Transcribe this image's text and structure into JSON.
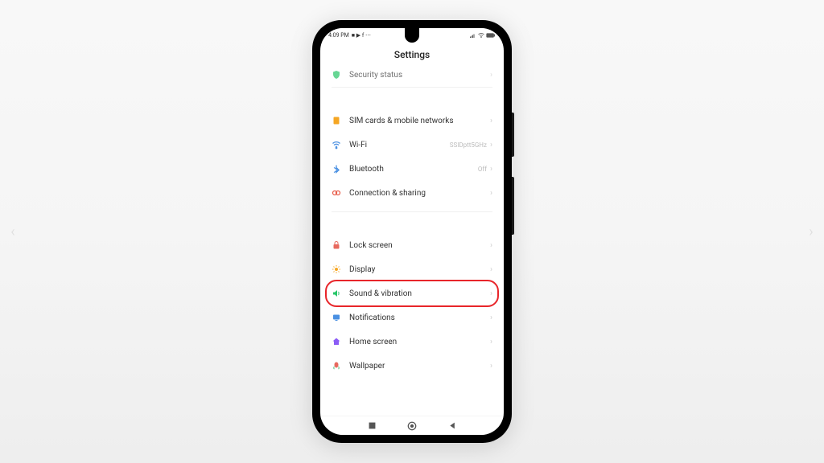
{
  "status": {
    "time": "4:09 PM",
    "icons_left": "■ ▶ f ⋯"
  },
  "header": {
    "title": "Settings"
  },
  "partial_item": {
    "label": "Security status"
  },
  "groups": [
    {
      "items": [
        {
          "icon": "sim",
          "color": "#f5a623",
          "label": "SIM cards & mobile networks",
          "value": ""
        },
        {
          "icon": "wifi",
          "color": "#4a90e2",
          "label": "Wi-Fi",
          "value": "SSIDptt5GHz"
        },
        {
          "icon": "bluetooth",
          "color": "#4a90e2",
          "label": "Bluetooth",
          "value": "Off"
        },
        {
          "icon": "connection",
          "color": "#e85d4a",
          "label": "Connection & sharing",
          "value": ""
        }
      ]
    },
    {
      "items": [
        {
          "icon": "lock",
          "color": "#e8695e",
          "label": "Lock screen",
          "value": ""
        },
        {
          "icon": "display",
          "color": "#f5a623",
          "label": "Display",
          "value": ""
        },
        {
          "icon": "sound",
          "color": "#27c668",
          "label": "Sound & vibration",
          "value": "",
          "highlighted": true
        },
        {
          "icon": "notifications",
          "color": "#4a90e2",
          "label": "Notifications",
          "value": ""
        },
        {
          "icon": "home",
          "color": "#8b5cf6",
          "label": "Home screen",
          "value": ""
        },
        {
          "icon": "wallpaper",
          "color": "#e8695e",
          "label": "Wallpaper",
          "value": ""
        }
      ]
    }
  ],
  "svg": {
    "shield": "<svg viewBox='0 0 24 24' fill='#27c668'><path d='M12 2l8 3v6c0 5-3.5 9.5-8 11-4.5-1.5-8-6-8-11V5l8-3z'/></svg>",
    "sim": "<svg viewBox='0 0 24 24' fill='#f5a623'><rect x='5' y='3' width='14' height='18' rx='2'/></svg>",
    "wifi": "<svg viewBox='0 0 24 24' fill='none' stroke='#4a90e2' stroke-width='2.5'><path d='M3 9c5-5 13-5 18 0M6 13c3.5-3.5 8.5-3.5 12 0M10 17c1-1 3-1 4 0'/><circle cx='12' cy='20' r='1.5' fill='#4a90e2'/></svg>",
    "bluetooth": "<svg viewBox='0 0 24 24' fill='none' stroke='#4a90e2' stroke-width='2.5'><path d='M12 3v18l6-6-12-6m0 12l12-6-6-6'/></svg>",
    "connection": "<svg viewBox='0 0 24 24' fill='none' stroke='#e85d4a' stroke-width='2.5'><circle cx='8' cy='12' r='5'/><circle cx='16' cy='12' r='5'/></svg>",
    "lock": "<svg viewBox='0 0 24 24' fill='#e8695e'><rect x='5' y='10' width='14' height='11' rx='2'/><path d='M8 10V7a4 4 0 018 0v3' fill='none' stroke='#e8695e' stroke-width='2'/></svg>",
    "display": "<svg viewBox='0 0 24 24' fill='#f5a623'><circle cx='12' cy='12' r='4'/><g stroke='#f5a623' stroke-width='2'><line x1='12' y1='2' x2='12' y2='5'/><line x1='12' y1='19' x2='12' y2='22'/><line x1='2' y1='12' x2='5' y2='12'/><line x1='19' y1='12' x2='22' y2='12'/><line x1='5' y1='5' x2='7' y2='7'/><line x1='17' y1='17' x2='19' y2='19'/><line x1='5' y1='19' x2='7' y2='17'/><line x1='17' y1='7' x2='19' y2='5'/></g></svg>",
    "sound": "<svg viewBox='0 0 24 24' fill='#27c668'><path d='M4 9v6h4l6 5V4L8 9H4z'/><path d='M17 8c1.5 1 1.5 7 0 8' fill='none' stroke='#27c668' stroke-width='2'/></svg>",
    "notifications": "<svg viewBox='0 0 24 24' fill='#4a90e2'><rect x='4' y='5' width='16' height='12' rx='2'/><rect x='9' y='18' width='6' height='2' fill='#4a90e2'/></svg>",
    "home": "<svg viewBox='0 0 24 24' fill='#8b5cf6'><path d='M12 3l9 8h-3v9H6v-9H3l9-8z'/></svg>",
    "wallpaper": "<svg viewBox='0 0 24 24' fill='#e8695e'><path d='M12 3c4 0 5 4 5 7 0 4-3 7-5 7s-5-3-5-7c0-3 1-7 5-7z'/><path d='M7 14c-2 2-2 5 0 6M17 14c2 2 2 5 0 6' stroke='#5bbf7e' stroke-width='2' fill='none'/></svg>",
    "signal": "<svg viewBox='0 0 16 12' fill='#555'><rect x='0' y='9' width='2' height='3'/><rect x='3' y='7' width='2' height='5'/><rect x='6' y='5' width='2' height='7'/><rect x='9' y='3' width='2' height='9'/></svg>",
    "wifi_s": "<svg viewBox='0 0 16 12' fill='none' stroke='#555' stroke-width='1.5'><path d='M1 4c4-4 10-4 14 0M4 7c2-2 6-2 8 0'/><circle cx='8' cy='10' r='1' fill='#555'/></svg>",
    "battery": "<svg viewBox='0 0 20 10' fill='none' stroke='#555' stroke-width='1'><rect x='1' y='1' width='15' height='8' rx='2'/><rect x='16' y='3' width='2' height='4' fill='#555'/><rect x='2' y='2' width='13' height='6' fill='#555'/></svg>"
  }
}
